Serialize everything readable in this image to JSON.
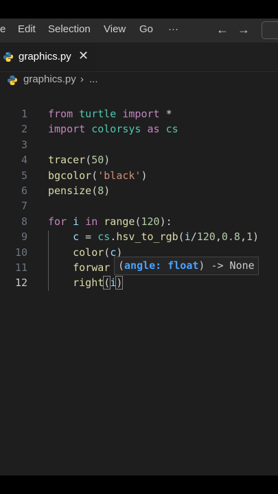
{
  "menu": {
    "items": [
      "e",
      "Edit",
      "Selection",
      "View",
      "Go",
      "···"
    ]
  },
  "nav": {
    "back": "←",
    "forward": "→"
  },
  "tab": {
    "filename": "graphics.py",
    "close": "✕"
  },
  "breadcrumb": {
    "file": "graphics.py",
    "separator": "›",
    "ellipsis": "..."
  },
  "editor": {
    "active_line": 12,
    "lines": [
      {
        "n": "1",
        "segments": [
          [
            "kw",
            "from"
          ],
          [
            "plain",
            " "
          ],
          [
            "mod",
            "turtle"
          ],
          [
            "plain",
            " "
          ],
          [
            "kw",
            "import"
          ],
          [
            "plain",
            " *"
          ]
        ]
      },
      {
        "n": "2",
        "segments": [
          [
            "kw",
            "import"
          ],
          [
            "plain",
            " "
          ],
          [
            "mod",
            "colorsys"
          ],
          [
            "plain",
            " "
          ],
          [
            "kw",
            "as"
          ],
          [
            "plain",
            " "
          ],
          [
            "mod",
            "cs"
          ]
        ]
      },
      {
        "n": "3",
        "segments": []
      },
      {
        "n": "4",
        "segments": [
          [
            "fn",
            "tracer"
          ],
          [
            "plain",
            "("
          ],
          [
            "num",
            "50"
          ],
          [
            "plain",
            ")"
          ]
        ]
      },
      {
        "n": "5",
        "segments": [
          [
            "fn",
            "bgcolor"
          ],
          [
            "plain",
            "("
          ],
          [
            "str",
            "'black'"
          ],
          [
            "plain",
            ")"
          ]
        ]
      },
      {
        "n": "6",
        "segments": [
          [
            "fn",
            "pensize"
          ],
          [
            "plain",
            "("
          ],
          [
            "num",
            "8"
          ],
          [
            "plain",
            ")"
          ]
        ]
      },
      {
        "n": "7",
        "segments": []
      },
      {
        "n": "8",
        "segments": [
          [
            "kw",
            "for"
          ],
          [
            "plain",
            " "
          ],
          [
            "var",
            "i"
          ],
          [
            "plain",
            " "
          ],
          [
            "kw",
            "in"
          ],
          [
            "plain",
            " "
          ],
          [
            "fn",
            "range"
          ],
          [
            "plain",
            "("
          ],
          [
            "num",
            "120"
          ],
          [
            "plain",
            "):"
          ]
        ]
      },
      {
        "n": "9",
        "segments": [
          [
            "plain",
            "    "
          ],
          [
            "var",
            "c"
          ],
          [
            "plain",
            " = "
          ],
          [
            "mod",
            "cs"
          ],
          [
            "plain",
            "."
          ],
          [
            "fn",
            "hsv_to_rgb"
          ],
          [
            "plain",
            "("
          ],
          [
            "var",
            "i"
          ],
          [
            "plain",
            "/"
          ],
          [
            "num",
            "120"
          ],
          [
            "plain",
            ","
          ],
          [
            "num",
            "0.8"
          ],
          [
            "plain",
            ","
          ],
          [
            "num",
            "1"
          ],
          [
            "plain",
            ")"
          ]
        ]
      },
      {
        "n": "10",
        "segments": [
          [
            "plain",
            "    "
          ],
          [
            "fn",
            "color"
          ],
          [
            "plain",
            "("
          ],
          [
            "var",
            "c"
          ],
          [
            "plain",
            ")"
          ]
        ]
      },
      {
        "n": "11",
        "segments": [
          [
            "plain",
            "    "
          ],
          [
            "fn",
            "forwar"
          ]
        ]
      },
      {
        "n": "12",
        "segments": [
          [
            "plain",
            "    "
          ],
          [
            "fn",
            "right"
          ],
          [
            "bracket",
            "("
          ],
          [
            "var",
            "i"
          ],
          [
            "bracket",
            ")"
          ]
        ]
      }
    ]
  },
  "signature_hint": {
    "open": "(",
    "param": "angle: float",
    "close": ") -> None"
  },
  "colors": {
    "keyword": "#c586c0",
    "module": "#4ec9b0",
    "function": "#dcdcaa",
    "number": "#b5cea8",
    "string": "#ce9178",
    "variable": "#9cdcfe",
    "python_blue": "#3776ab",
    "python_yellow": "#ffd43b"
  }
}
